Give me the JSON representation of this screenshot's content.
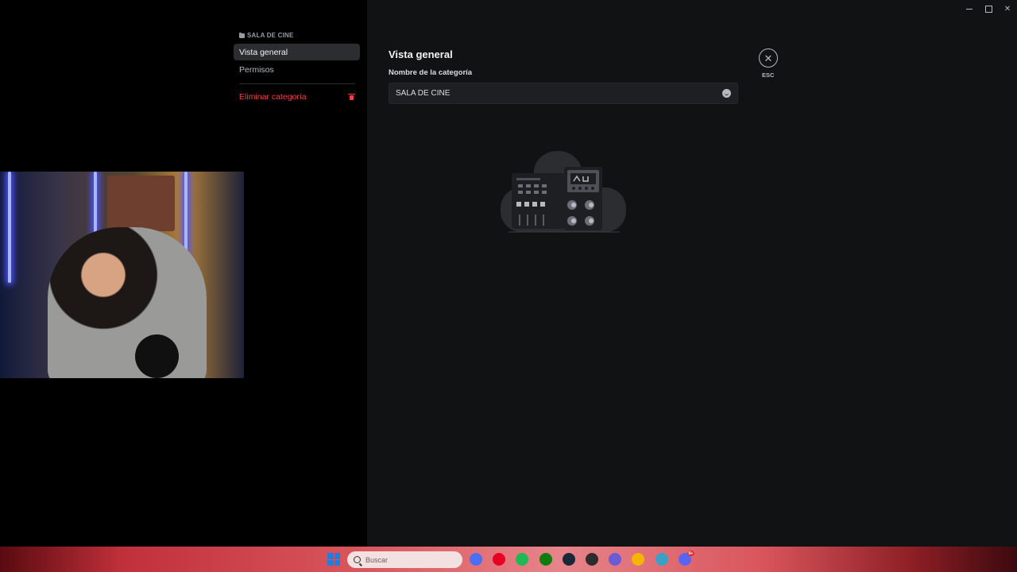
{
  "sidebar": {
    "category_header": "SALA DE CINE",
    "items": [
      {
        "label": "Vista general",
        "selected": true
      },
      {
        "label": "Permisos",
        "selected": false
      }
    ],
    "delete_label": "Eliminar categoría"
  },
  "main": {
    "title": "Vista general",
    "field_label": "Nombre de la categoría",
    "field_value": "SALA DE CINE",
    "close_hint": "ESC"
  },
  "taskbar": {
    "search_placeholder": "Buscar",
    "apps": [
      {
        "name": "roblox",
        "color": "#4a6ef5"
      },
      {
        "name": "pinterest",
        "color": "#e60023"
      },
      {
        "name": "spotify",
        "color": "#1db954"
      },
      {
        "name": "xbox",
        "color": "#107c10"
      },
      {
        "name": "steam",
        "color": "#1b2838"
      },
      {
        "name": "vpn",
        "color": "#2c2c2c"
      },
      {
        "name": "settings",
        "color": "#6b5bd6"
      },
      {
        "name": "chrome",
        "color": "#f4b400"
      },
      {
        "name": "edge",
        "color": "#3aa0c8"
      },
      {
        "name": "discord",
        "color": "#5865f2",
        "badge": "9+"
      }
    ]
  },
  "colors": {
    "background": "#111214",
    "sidebar": "#000000",
    "selected_item": "#2b2d31",
    "danger": "#f23f43"
  }
}
